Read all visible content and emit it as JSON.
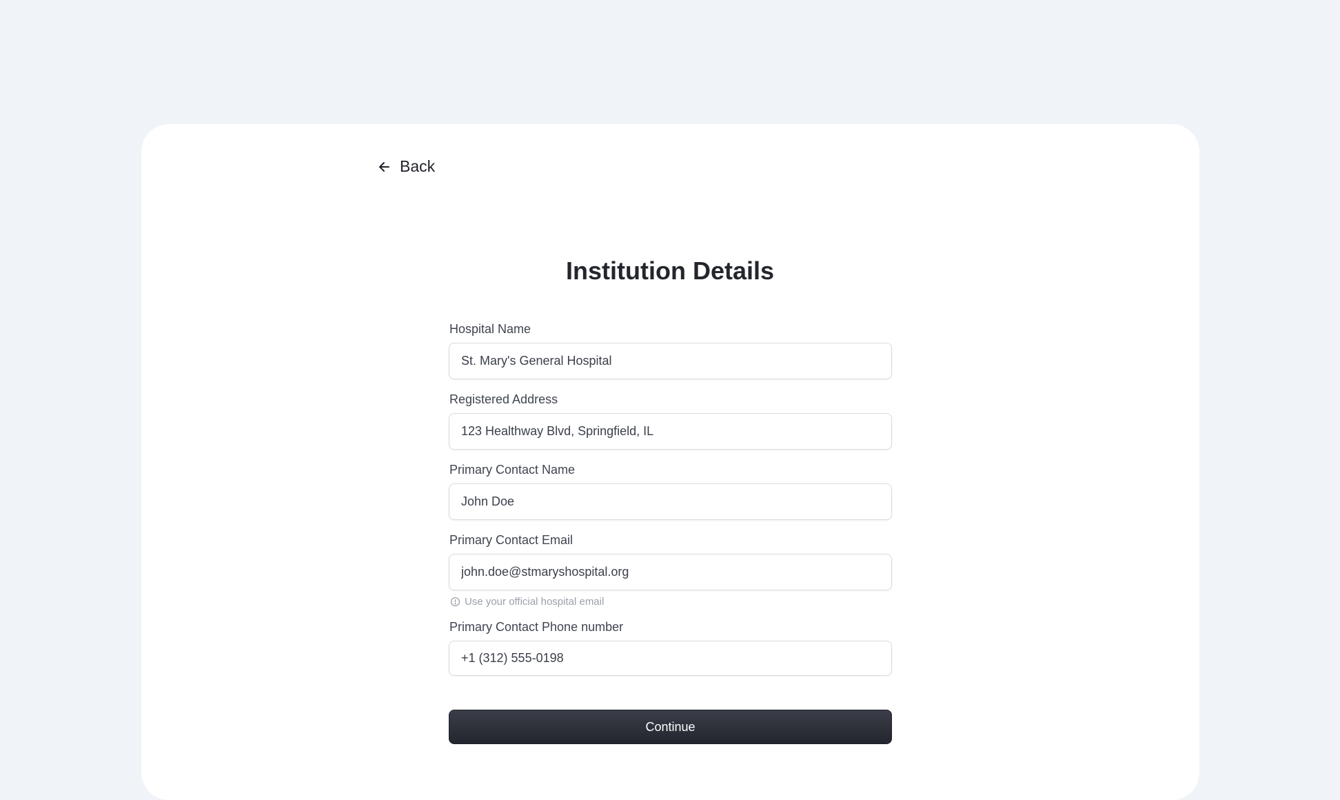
{
  "nav": {
    "back_label": "Back"
  },
  "page": {
    "title": "Institution Details"
  },
  "form": {
    "fields": [
      {
        "label": "Hospital Name",
        "value": "St. Mary's General Hospital"
      },
      {
        "label": "Registered Address",
        "value": "123 Healthway Blvd, Springfield, IL"
      },
      {
        "label": "Primary Contact Name",
        "value": "John Doe"
      },
      {
        "label": "Primary Contact Email",
        "value": "john.doe@stmaryshospital.org",
        "hint": "Use your official hospital email"
      },
      {
        "label": "Primary Contact Phone number",
        "value": "+1 (312) 555-0198"
      }
    ],
    "continue_label": "Continue"
  },
  "icons": {
    "back": "arrow-left-icon",
    "hint": "info-circle-icon"
  },
  "colors": {
    "background": "#f0f3f8",
    "card": "#ffffff",
    "button": "#2a2d35"
  }
}
